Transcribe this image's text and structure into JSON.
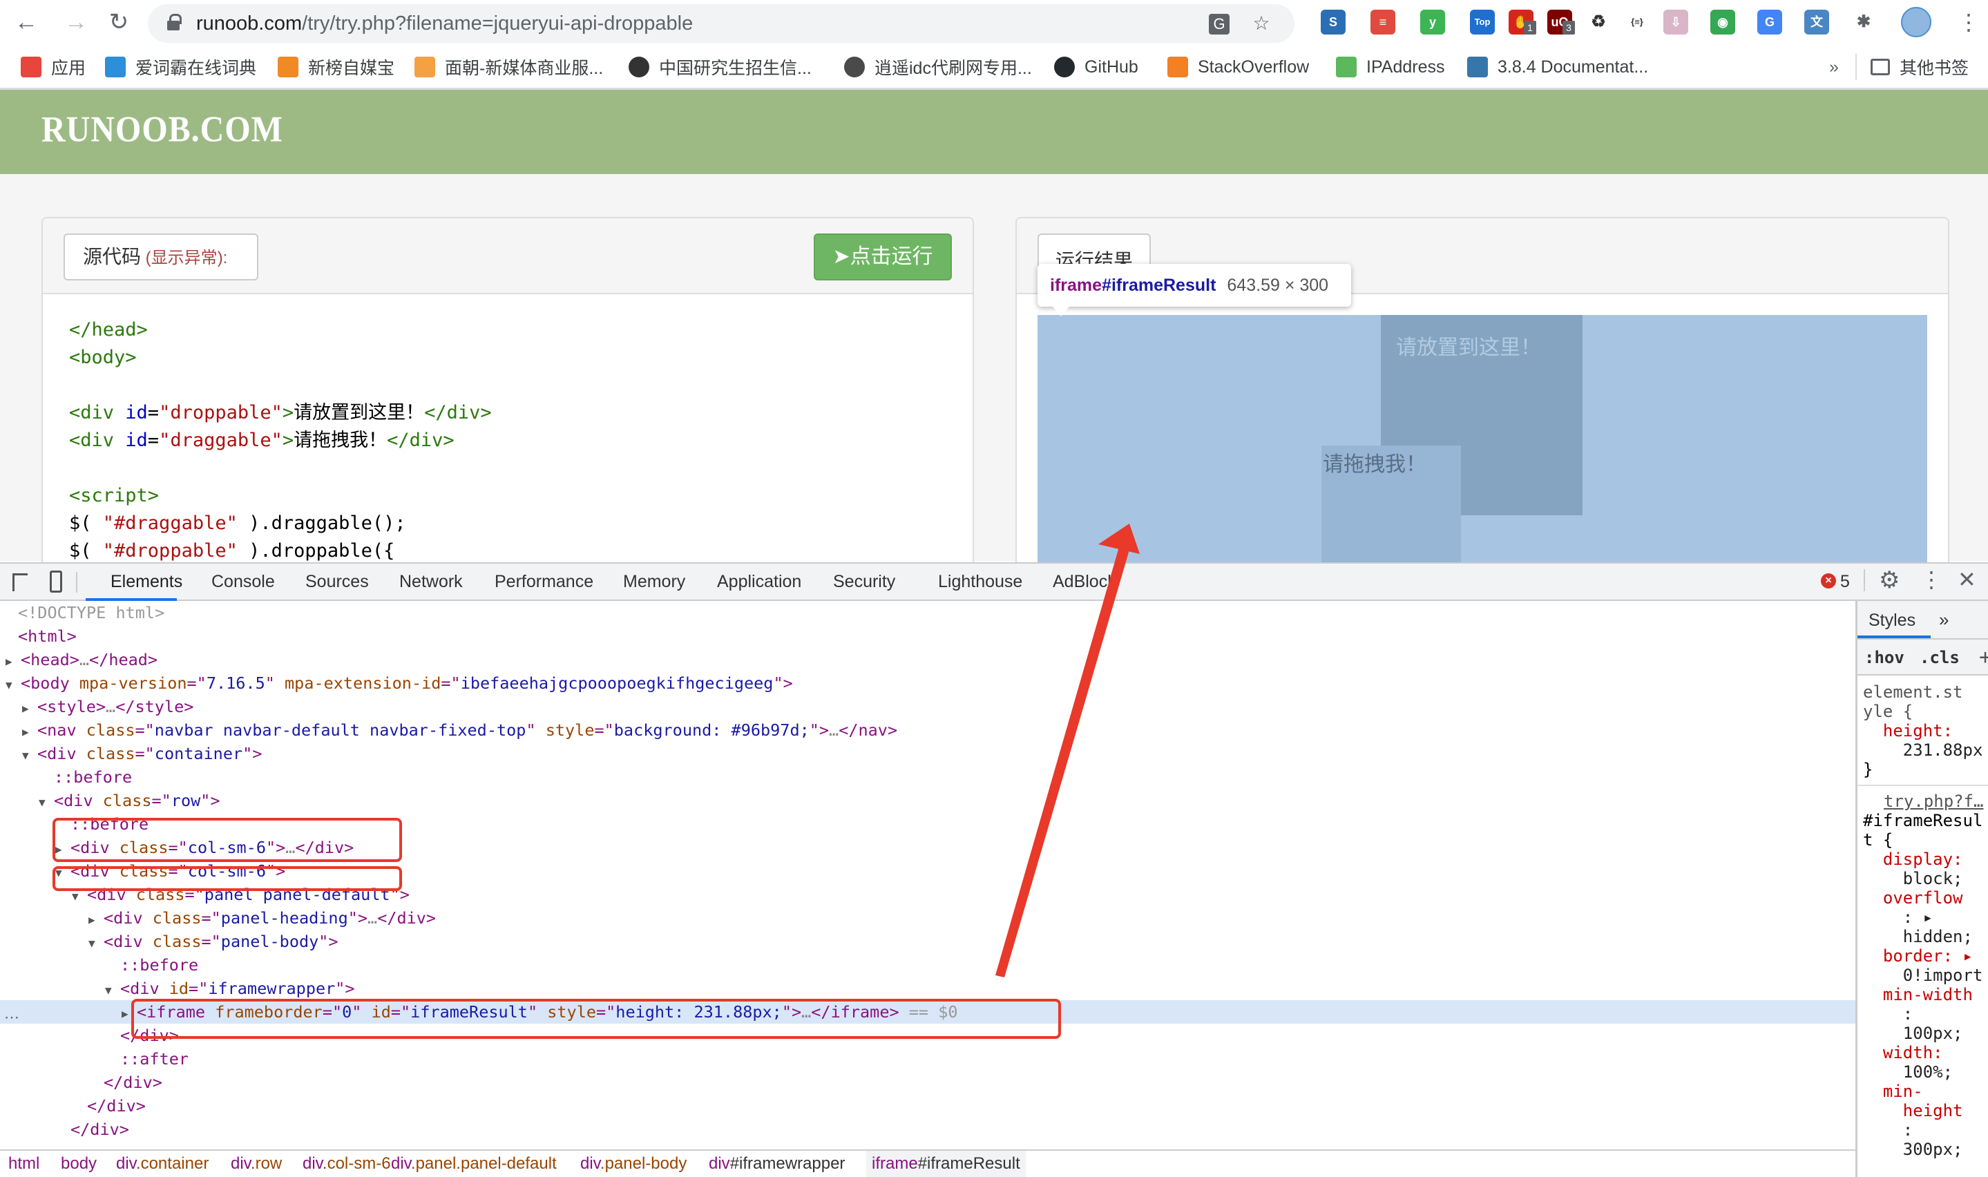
{
  "browser": {
    "url_host": "runoob.com",
    "url_path": "/try/try.php?filename=jqueryui-api-droppable",
    "extensions": [
      {
        "name": "s-ext",
        "glyph": "S",
        "color": "#2a6fb5"
      },
      {
        "name": "notes-ext",
        "glyph": "≡",
        "color": "#e04b3f"
      },
      {
        "name": "y-ext",
        "glyph": "y",
        "color": "#3cb554"
      },
      {
        "name": "tophub-ext",
        "glyph": "Top",
        "color": "#1f6fd0"
      },
      {
        "name": "adblock-ext",
        "glyph": "✋",
        "color": "#d9241c",
        "badge": "1"
      },
      {
        "name": "ublock-ext",
        "glyph": "uO",
        "color": "#800000",
        "badge": "3"
      },
      {
        "name": "recycle-ext",
        "glyph": "♻",
        "color": "#333333"
      },
      {
        "name": "json-ext",
        "glyph": "{≡}",
        "color": "#333333"
      },
      {
        "name": "folder-ext",
        "glyph": "⇩",
        "color": "#d9b5c8"
      },
      {
        "name": "chrome-ext",
        "glyph": "◉",
        "color": "#34a853"
      },
      {
        "name": "translate-ext",
        "glyph": "G",
        "color": "#4285f4"
      },
      {
        "name": "dict-ext",
        "glyph": "文",
        "color": "#4a86c5"
      },
      {
        "name": "puzzle-ext",
        "glyph": "✱",
        "color": "#5f6368"
      }
    ]
  },
  "bookmarks": [
    {
      "label": "应用",
      "icon": "apps-grid-icon"
    },
    {
      "label": "爱词霸在线词典",
      "icon": "iciba-icon"
    },
    {
      "label": "新榜自媒宝",
      "icon": "newrank-icon"
    },
    {
      "label": "面朝-新媒体商业服...",
      "icon": "mianchao-icon"
    },
    {
      "label": "中国研究生招生信...",
      "icon": "graduation-cap-icon"
    },
    {
      "label": "逍遥idc代刷网专用...",
      "icon": "globe-icon"
    },
    {
      "label": "GitHub",
      "icon": "github-icon"
    },
    {
      "label": "StackOverflow",
      "icon": "stackoverflow-icon"
    },
    {
      "label": "IPAddress",
      "icon": "ipaddress-icon"
    },
    {
      "label": "3.8.4 Documentat...",
      "icon": "python-icon"
    }
  ],
  "bookmarks_overflow": "»",
  "other_bookmarks": "其他书签",
  "site": {
    "logo": "RUNOOB.COM",
    "source_label": "源代码",
    "source_paren_open": " (",
    "source_error_link": "显示异常",
    "source_paren_close": "):",
    "run_button": "点击运行",
    "result_tab": "运行结果",
    "code_lines": [
      [
        {
          "c": "tg",
          "t": "</head>"
        }
      ],
      [
        {
          "c": "tg",
          "t": "<body>"
        }
      ],
      [],
      [
        {
          "c": "tg",
          "t": "<div "
        },
        {
          "c": "at",
          "t": "id"
        },
        {
          "c": "",
          "t": "="
        },
        {
          "c": "sv",
          "t": "\"droppable\""
        },
        {
          "c": "tg",
          "t": ">"
        },
        {
          "c": "",
          "t": "请放置到这里！"
        },
        {
          "c": "tg",
          "t": "</div>"
        }
      ],
      [
        {
          "c": "tg",
          "t": "<div "
        },
        {
          "c": "at",
          "t": "id"
        },
        {
          "c": "",
          "t": "="
        },
        {
          "c": "sv",
          "t": "\"draggable\""
        },
        {
          "c": "tg",
          "t": ">"
        },
        {
          "c": "",
          "t": "请拖拽我！"
        },
        {
          "c": "tg",
          "t": "</div>"
        }
      ],
      [],
      [
        {
          "c": "tg",
          "t": "<script>"
        }
      ],
      [
        {
          "c": "",
          "t": "$( "
        },
        {
          "c": "sv",
          "t": "\"#draggable\""
        },
        {
          "c": "",
          "t": " ).draggable();"
        }
      ],
      [
        {
          "c": "",
          "t": "$( "
        },
        {
          "c": "sv",
          "t": "\"#droppable\""
        },
        {
          "c": "",
          "t": " ).droppable({"
        }
      ]
    ],
    "droppable_text": "请放置到这里！",
    "draggable_text": "请拖拽我！"
  },
  "inspect_tooltip": {
    "tag": "iframe",
    "id": "#iframeResult",
    "size": "643.59 × 300"
  },
  "devtools": {
    "tabs": [
      "Elements",
      "Console",
      "Sources",
      "Network",
      "Performance",
      "Memory",
      "Application",
      "Security",
      "Lighthouse",
      "AdBlock"
    ],
    "active_tab": "Elements",
    "error_count": "5",
    "tree": [
      {
        "indent": 0,
        "tri": "",
        "html": [
          [
            "dim",
            "<!DOCTYPE html>"
          ]
        ]
      },
      {
        "indent": 0,
        "tri": "",
        "html": [
          [
            "t",
            "<html>"
          ]
        ]
      },
      {
        "indent": 0,
        "tri": "▶",
        "html": [
          [
            "t",
            "<head>"
          ],
          [
            "q",
            "…"
          ],
          [
            "t",
            "</head>"
          ]
        ]
      },
      {
        "indent": 0,
        "tri": "▼",
        "html": [
          [
            "t",
            "<body "
          ],
          [
            "an",
            "mpa-version"
          ],
          [
            "t",
            "=\""
          ],
          [
            "av",
            "7.16.5"
          ],
          [
            "t",
            "\" "
          ],
          [
            "an",
            "mpa-extension-id"
          ],
          [
            "t",
            "=\""
          ],
          [
            "av",
            "ibefaeehajgcpooopoegkifhgecigeeg"
          ],
          [
            "t",
            "\">"
          ]
        ]
      },
      {
        "indent": 1,
        "tri": "▶",
        "html": [
          [
            "t",
            "<style>"
          ],
          [
            "q",
            "…"
          ],
          [
            "t",
            "</style>"
          ]
        ]
      },
      {
        "indent": 1,
        "tri": "▶",
        "html": [
          [
            "t",
            "<nav "
          ],
          [
            "an",
            "class"
          ],
          [
            "t",
            "=\""
          ],
          [
            "av",
            "navbar navbar-default navbar-fixed-top"
          ],
          [
            "t",
            "\" "
          ],
          [
            "an",
            "style"
          ],
          [
            "t",
            "=\""
          ],
          [
            "av",
            "background: #96b97d;"
          ],
          [
            "t",
            "\">"
          ],
          [
            "q",
            "…"
          ],
          [
            "t",
            "</nav>"
          ]
        ]
      },
      {
        "indent": 1,
        "tri": "▼",
        "html": [
          [
            "t",
            "<div "
          ],
          [
            "an",
            "class"
          ],
          [
            "t",
            "=\""
          ],
          [
            "av",
            "container"
          ],
          [
            "t",
            "\">"
          ]
        ]
      },
      {
        "indent": 2,
        "tri": "",
        "html": [
          [
            "ps",
            "::before"
          ]
        ]
      },
      {
        "indent": 2,
        "tri": "▼",
        "html": [
          [
            "t",
            "<div "
          ],
          [
            "an",
            "class"
          ],
          [
            "t",
            "=\""
          ],
          [
            "av",
            "row"
          ],
          [
            "t",
            "\">"
          ]
        ]
      },
      {
        "indent": 3,
        "tri": "",
        "html": [
          [
            "ps",
            "::before"
          ]
        ]
      },
      {
        "indent": 3,
        "tri": "▶",
        "html": [
          [
            "t",
            "<div "
          ],
          [
            "an",
            "class"
          ],
          [
            "t",
            "=\""
          ],
          [
            "av",
            "col-sm-6"
          ],
          [
            "t",
            "\">"
          ],
          [
            "q",
            "…"
          ],
          [
            "t",
            "</div>"
          ]
        ]
      },
      {
        "indent": 3,
        "tri": "▼",
        "html": [
          [
            "t",
            "<div "
          ],
          [
            "an",
            "class"
          ],
          [
            "t",
            "=\""
          ],
          [
            "av",
            "col-sm-6"
          ],
          [
            "t",
            "\">"
          ]
        ]
      },
      {
        "indent": 4,
        "tri": "▼",
        "html": [
          [
            "t",
            "<div "
          ],
          [
            "an",
            "class"
          ],
          [
            "t",
            "=\""
          ],
          [
            "av",
            "panel panel-default"
          ],
          [
            "t",
            "\">"
          ]
        ]
      },
      {
        "indent": 5,
        "tri": "▶",
        "html": [
          [
            "t",
            "<div "
          ],
          [
            "an",
            "class"
          ],
          [
            "t",
            "=\""
          ],
          [
            "av",
            "panel-heading"
          ],
          [
            "t",
            "\">"
          ],
          [
            "q",
            "…"
          ],
          [
            "t",
            "</div>"
          ]
        ]
      },
      {
        "indent": 5,
        "tri": "▼",
        "html": [
          [
            "t",
            "<div "
          ],
          [
            "an",
            "class"
          ],
          [
            "t",
            "=\""
          ],
          [
            "av",
            "panel-body"
          ],
          [
            "t",
            "\">"
          ]
        ]
      },
      {
        "indent": 6,
        "tri": "",
        "html": [
          [
            "ps",
            "::before"
          ]
        ]
      },
      {
        "indent": 6,
        "tri": "▼",
        "html": [
          [
            "t",
            "<div "
          ],
          [
            "an",
            "id"
          ],
          [
            "t",
            "=\""
          ],
          [
            "av",
            "iframewrapper"
          ],
          [
            "t",
            "\">"
          ]
        ]
      },
      {
        "indent": 7,
        "tri": "▶",
        "selected": true,
        "html": [
          [
            "t",
            "<iframe "
          ],
          [
            "an",
            "frameborder"
          ],
          [
            "t",
            "=\""
          ],
          [
            "av",
            "0"
          ],
          [
            "t",
            "\" "
          ],
          [
            "an",
            "id"
          ],
          [
            "t",
            "=\""
          ],
          [
            "av",
            "iframeResult"
          ],
          [
            "t",
            "\" "
          ],
          [
            "an",
            "style"
          ],
          [
            "t",
            "=\""
          ],
          [
            "av",
            "height: 231.88px;"
          ],
          [
            "t",
            "\">"
          ],
          [
            "q",
            "…"
          ],
          [
            "t",
            "</iframe>"
          ],
          [
            "dim",
            " == $0"
          ]
        ]
      },
      {
        "indent": 6,
        "tri": "",
        "html": [
          [
            "t",
            "</div>"
          ]
        ]
      },
      {
        "indent": 6,
        "tri": "",
        "html": [
          [
            "ps",
            "::after"
          ]
        ]
      },
      {
        "indent": 5,
        "tri": "",
        "html": [
          [
            "t",
            "</div>"
          ]
        ]
      },
      {
        "indent": 4,
        "tri": "",
        "html": [
          [
            "t",
            "</div>"
          ]
        ]
      },
      {
        "indent": 3,
        "tri": "",
        "html": [
          [
            "t",
            "</div>"
          ]
        ]
      }
    ],
    "breadcrumbs": [
      {
        "tag": "html",
        "cls": ""
      },
      {
        "tag": "body",
        "cls": ""
      },
      {
        "tag": "div",
        "cls": ".container"
      },
      {
        "tag": "div",
        "cls": ".row"
      },
      {
        "tag": "div",
        "cls": ".col-sm-6"
      },
      {
        "tag": "div",
        "cls": ".panel.panel-default"
      },
      {
        "tag": "div",
        "cls": ".panel-body"
      },
      {
        "tag": "div",
        "cls": "#iframewrapper"
      },
      {
        "tag": "iframe",
        "cls": "#iframeResult",
        "active": true
      }
    ],
    "styles": {
      "tab": "Styles",
      "more": "»",
      "hov": ":hov",
      "cls": ".cls",
      "plus": "+",
      "element_style_selector": [
        "element.st",
        "yle {"
      ],
      "element_style_props": [
        [
          "height:",
          "231.88px"
        ]
      ],
      "source_link": "try.php?f…",
      "rule_selector": [
        "#iframeResul",
        "t {"
      ],
      "rule_lines": [
        [
          "pn",
          "  display:"
        ],
        [
          "pv",
          "    block;"
        ],
        [
          "pn",
          "  overflow"
        ],
        [
          "pv",
          "    : ▸"
        ],
        [
          "pv",
          "    hidden;"
        ],
        [
          "pn",
          "  border: ▸"
        ],
        [
          "pv",
          "    0!import"
        ],
        [
          "pn",
          "  min-width"
        ],
        [
          "pv",
          "    :"
        ],
        [
          "pv",
          "    100px;"
        ],
        [
          "pn",
          "  width:"
        ],
        [
          "pv",
          "    100%;"
        ],
        [
          "pn",
          "  min-"
        ],
        [
          "pn",
          "    height"
        ],
        [
          "pv",
          "    :"
        ],
        [
          "pv",
          "    300px;"
        ]
      ]
    }
  },
  "annotation_color": "#e8392a"
}
